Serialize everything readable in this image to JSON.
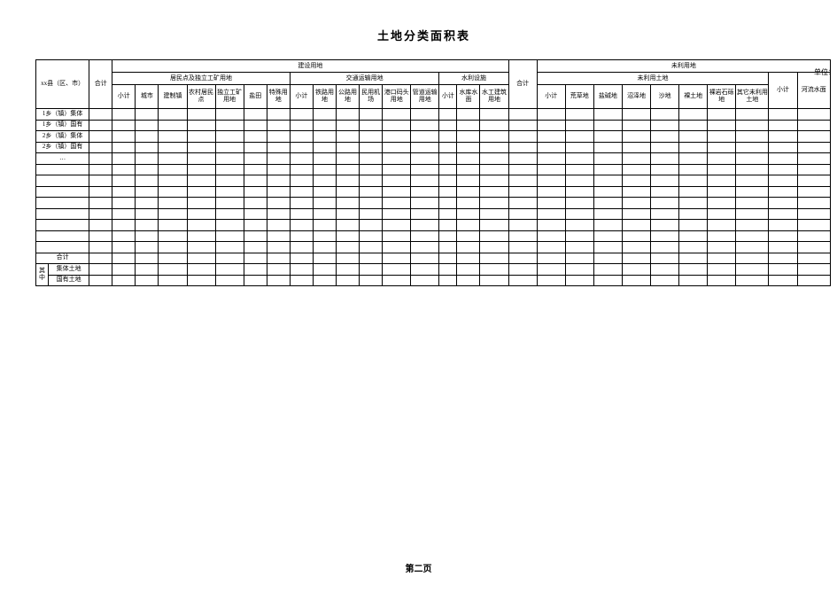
{
  "title": "土地分类面积表",
  "unit_label": "单位：",
  "footer": "第二页",
  "header": {
    "region": "xx县（区、市）",
    "heji": "合计",
    "group_construction": "建设用地",
    "group_unused": "未利用地",
    "sub_settlement": "居民点及独立工矿用地",
    "sub_traffic": "交通运输用地",
    "sub_water": "水利设施",
    "sub_unused_land": "未利用土地",
    "xiaoji": "小计",
    "city": "城市",
    "town": "建制镇",
    "rural_settlement": "农村居民点",
    "independent_mining": "独立工矿用地",
    "salt_field": "盐田",
    "special": "特殊用地",
    "railway": "铁路用地",
    "highway": "公路用地",
    "airport": "民用机场",
    "port": "港口码头用地",
    "pipeline": "管道运输用地",
    "reservoir": "水库水面",
    "hydraulic": "水工建筑用地",
    "barren_grass": "荒草地",
    "saline": "盐碱地",
    "marsh": "沼泽地",
    "sand": "沙地",
    "bare_land": "裸土地",
    "bare_rock": "裸岩石砾地",
    "other_unused": "其它未利用土地",
    "river": "河流水面"
  },
  "rows": {
    "r1": "1乡（镇）集体",
    "r2": "1乡（镇）国有",
    "r3": "2乡（镇）集体",
    "r4": "2乡（镇）国有",
    "r5": "…",
    "r_heji": "合计",
    "r_qizhong": "其中",
    "r_collective": "集体土地",
    "r_state": "国有土地"
  }
}
